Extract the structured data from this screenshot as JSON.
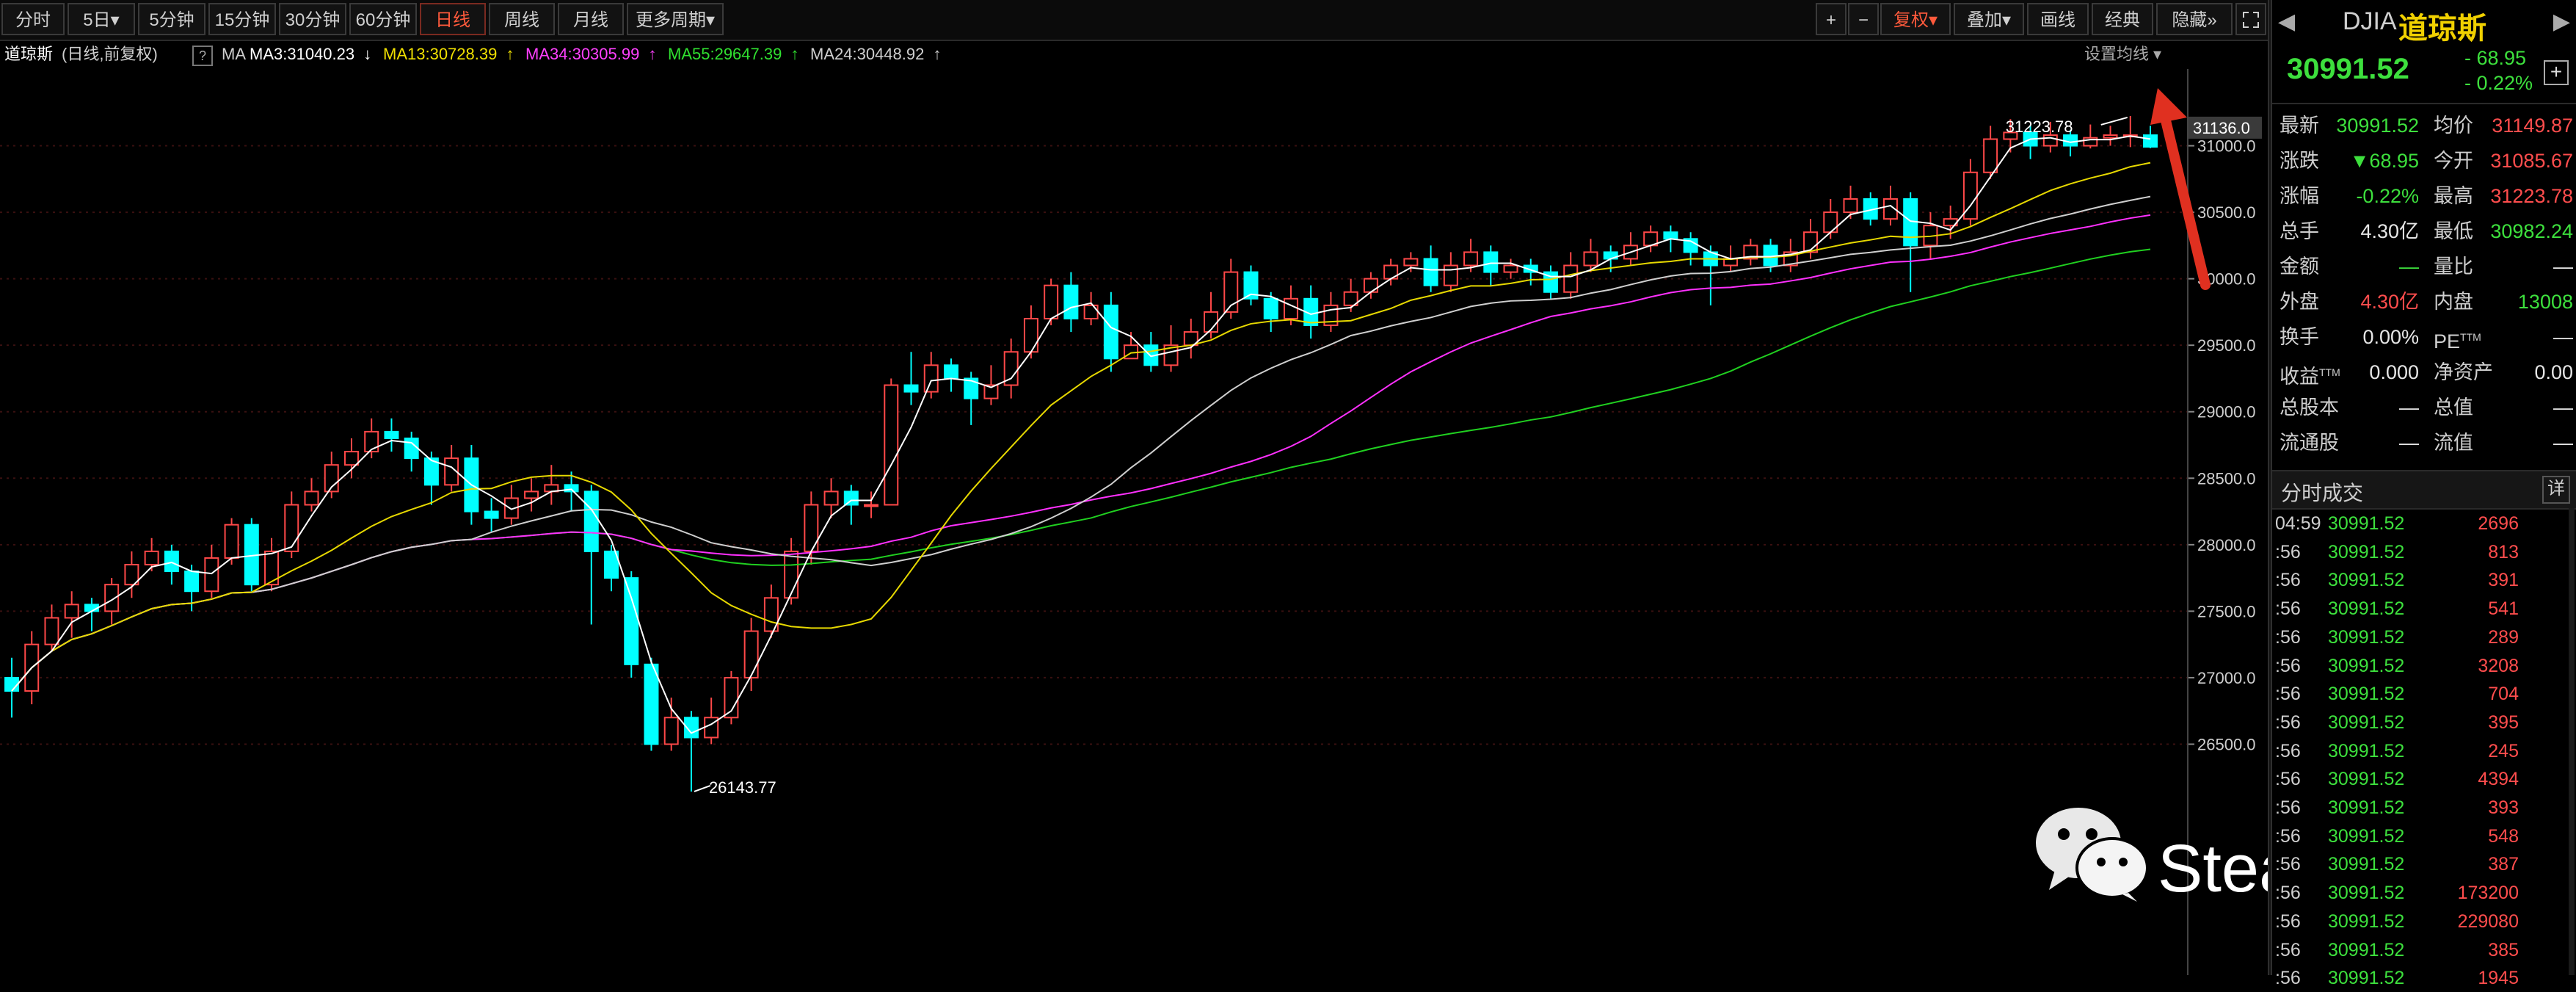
{
  "toolbar": {
    "periods": [
      "分时",
      "5日",
      "5分钟",
      "15分钟",
      "30分钟",
      "60分钟",
      "日线",
      "周线",
      "月线",
      "更多周期"
    ],
    "active_period": "日线",
    "more_arrow": "▾",
    "plus": "+",
    "minus": "−",
    "fuquan": "复权",
    "overlay": "叠加",
    "draw": "画线",
    "classic": "经典",
    "hide": "隐藏",
    "hide_arrows": "»",
    "fullscreen_icon": "fullscreen-icon"
  },
  "ma_bar": {
    "name": "道琼斯",
    "subtitle": "(日线,前复权)",
    "question": "?",
    "ma_label": "MA",
    "settings": "设置均线",
    "items": [
      {
        "text": "MA3:31040.23",
        "arrow": "↓",
        "color": "#ffffff"
      },
      {
        "text": "MA13:30728.39",
        "arrow": "↑",
        "color": "#f0e000"
      },
      {
        "text": "MA34:30305.99",
        "arrow": "↑",
        "color": "#ff40ff"
      },
      {
        "text": "MA55:29647.39",
        "arrow": "↑",
        "color": "#30e030"
      },
      {
        "text": "MA24:30448.92",
        "arrow": "↑",
        "color": "#cfcfcf"
      }
    ]
  },
  "chart_data": {
    "type": "candlestick",
    "ylim": [
      26143.77,
      31223.78
    ],
    "y_ticks": [
      "31000.0",
      "30500.0",
      "30000.0",
      "29500.0",
      "29000.0",
      "28500.0",
      "28000.0",
      "27500.0",
      "27000.0",
      "26500.0"
    ],
    "current_price_label": "31136.0",
    "high_label": "31223.78",
    "low_label": "26143.77",
    "colors": {
      "up": "#ff4848",
      "down": "#00ffff",
      "ma3": "#ffffff",
      "ma13": "#e6d800",
      "ma24": "#cfcfcf",
      "ma34": "#ff30ff",
      "ma55": "#20d020",
      "grid": "#3a1010"
    },
    "candles": [
      [
        27000,
        26900,
        27150,
        26700
      ],
      [
        26900,
        27250,
        27350,
        26800
      ],
      [
        27250,
        27450,
        27550,
        27200
      ],
      [
        27450,
        27550,
        27650,
        27300
      ],
      [
        27550,
        27500,
        27600,
        27350
      ],
      [
        27500,
        27700,
        27750,
        27400
      ],
      [
        27700,
        27850,
        27950,
        27600
      ],
      [
        27850,
        27950,
        28050,
        27800
      ],
      [
        27950,
        27800,
        28000,
        27700
      ],
      [
        27800,
        27650,
        27850,
        27500
      ],
      [
        27650,
        27900,
        28000,
        27600
      ],
      [
        27900,
        28150,
        28200,
        27850
      ],
      [
        28150,
        27700,
        28200,
        27650
      ],
      [
        27700,
        27950,
        28050,
        27650
      ],
      [
        27950,
        28300,
        28400,
        27900
      ],
      [
        28300,
        28400,
        28500,
        28250
      ],
      [
        28400,
        28600,
        28700,
        28350
      ],
      [
        28600,
        28700,
        28800,
        28500
      ],
      [
        28700,
        28850,
        28950,
        28650
      ],
      [
        28850,
        28800,
        28950,
        28700
      ],
      [
        28800,
        28650,
        28850,
        28550
      ],
      [
        28650,
        28450,
        28700,
        28300
      ],
      [
        28450,
        28650,
        28750,
        28400
      ],
      [
        28650,
        28250,
        28750,
        28150
      ],
      [
        28250,
        28200,
        28350,
        28100
      ],
      [
        28200,
        28350,
        28450,
        28150
      ],
      [
        28350,
        28400,
        28500,
        28250
      ],
      [
        28400,
        28450,
        28600,
        28300
      ],
      [
        28450,
        28400,
        28550,
        28250
      ],
      [
        28400,
        27950,
        28450,
        27400
      ],
      [
        27950,
        27750,
        28000,
        27650
      ],
      [
        27750,
        27100,
        27800,
        27000
      ],
      [
        27100,
        26500,
        27150,
        26450
      ],
      [
        26500,
        26700,
        26850,
        26450
      ],
      [
        26700,
        26550,
        26750,
        26144
      ],
      [
        26550,
        26700,
        26850,
        26500
      ],
      [
        26700,
        27000,
        27050,
        26650
      ],
      [
        27000,
        27350,
        27450,
        26900
      ],
      [
        27350,
        27600,
        27700,
        27300
      ],
      [
        27600,
        27950,
        28050,
        27550
      ],
      [
        27950,
        28300,
        28400,
        27850
      ],
      [
        28300,
        28400,
        28500,
        28200
      ],
      [
        28400,
        28300,
        28450,
        28150
      ],
      [
        28300,
        28300,
        28400,
        28200
      ],
      [
        28300,
        29200,
        29250,
        28950
      ],
      [
        29200,
        29150,
        29450,
        29050
      ],
      [
        29150,
        29350,
        29450,
        29100
      ],
      [
        29350,
        29250,
        29400,
        29150
      ],
      [
        29250,
        29100,
        29300,
        28900
      ],
      [
        29100,
        29200,
        29350,
        29050
      ],
      [
        29200,
        29450,
        29550,
        29100
      ],
      [
        29450,
        29700,
        29800,
        29400
      ],
      [
        29700,
        29950,
        30000,
        29650
      ],
      [
        29950,
        29700,
        30050,
        29600
      ],
      [
        29700,
        29800,
        29900,
        29650
      ],
      [
        29800,
        29400,
        29900,
        29300
      ],
      [
        29400,
        29500,
        29600,
        29400
      ],
      [
        29500,
        29350,
        29600,
        29300
      ],
      [
        29350,
        29500,
        29650,
        29300
      ],
      [
        29500,
        29600,
        29700,
        29400
      ],
      [
        29600,
        29750,
        29900,
        29550
      ],
      [
        29750,
        30050,
        30150,
        29700
      ],
      [
        30050,
        29850,
        30100,
        29800
      ],
      [
        29850,
        29700,
        29900,
        29600
      ],
      [
        29700,
        29850,
        29950,
        29650
      ],
      [
        29850,
        29650,
        29950,
        29550
      ],
      [
        29650,
        29800,
        29900,
        29600
      ],
      [
        29800,
        29900,
        30000,
        29750
      ],
      [
        29900,
        30000,
        30050,
        29850
      ],
      [
        30000,
        30100,
        30150,
        29950
      ],
      [
        30100,
        30150,
        30200,
        30050
      ],
      [
        30150,
        29950,
        30250,
        29900
      ],
      [
        29950,
        30100,
        30200,
        29900
      ],
      [
        30100,
        30200,
        30300,
        30050
      ],
      [
        30200,
        30050,
        30250,
        29950
      ],
      [
        30050,
        30100,
        30150,
        30000
      ],
      [
        30100,
        30050,
        30150,
        29950
      ],
      [
        30050,
        29900,
        30100,
        29850
      ],
      [
        29900,
        30100,
        30200,
        29850
      ],
      [
        30100,
        30200,
        30300,
        30050
      ],
      [
        30200,
        30150,
        30250,
        30050
      ],
      [
        30150,
        30250,
        30350,
        30100
      ],
      [
        30250,
        30350,
        30400,
        30200
      ],
      [
        30350,
        30300,
        30400,
        30200
      ],
      [
        30300,
        30200,
        30350,
        30100
      ],
      [
        30200,
        30100,
        30250,
        29800
      ],
      [
        30100,
        30150,
        30250,
        30050
      ],
      [
        30150,
        30250,
        30300,
        30100
      ],
      [
        30250,
        30100,
        30300,
        30050
      ],
      [
        30100,
        30200,
        30300,
        30050
      ],
      [
        30200,
        30350,
        30450,
        30150
      ],
      [
        30350,
        30500,
        30600,
        30300
      ],
      [
        30500,
        30600,
        30700,
        30450
      ],
      [
        30600,
        30450,
        30650,
        30400
      ],
      [
        30450,
        30600,
        30700,
        30400
      ],
      [
        30600,
        30250,
        30650,
        29900
      ],
      [
        30250,
        30400,
        30500,
        30150
      ],
      [
        30400,
        30450,
        30550,
        30300
      ],
      [
        30450,
        30800,
        30900,
        30400
      ],
      [
        30800,
        31050,
        31150,
        30750
      ],
      [
        31050,
        31100,
        31200,
        30950
      ],
      [
        31100,
        31000,
        31150,
        30900
      ],
      [
        31000,
        31080,
        31180,
        30950
      ],
      [
        31080,
        31000,
        31120,
        30920
      ],
      [
        31000,
        31060,
        31160,
        30980
      ],
      [
        31060,
        31080,
        31150,
        31000
      ],
      [
        31080,
        31080,
        31224,
        30990
      ],
      [
        31080,
        30992,
        31150,
        30982
      ]
    ]
  },
  "quote": {
    "code": "DJIA",
    "name": "道琼斯",
    "price": "30991.52",
    "change": "- 68.95",
    "change_pct": "- 0.22%",
    "add": "+",
    "rows": [
      {
        "l1": "最新",
        "v1": "30991.52",
        "c1": "green",
        "l2": "均价",
        "v2": "31149.87",
        "c2": "red"
      },
      {
        "l1": "涨跌",
        "v1": "▼68.95",
        "c1": "green",
        "l2": "今开",
        "v2": "31085.67",
        "c2": "red"
      },
      {
        "l1": "涨幅",
        "v1": "-0.22%",
        "c1": "green",
        "l2": "最高",
        "v2": "31223.78",
        "c2": "red"
      },
      {
        "l1": "总手",
        "v1": "4.30亿",
        "c1": "white",
        "l2": "最低",
        "v2": "30982.24",
        "c2": "green"
      },
      {
        "l1": "金额",
        "v1": "—",
        "c1": "green",
        "l2": "量比",
        "v2": "—",
        "c2": "white"
      },
      {
        "l1": "外盘",
        "v1": "4.30亿",
        "c1": "red",
        "l2": "内盘",
        "v2": "13008",
        "c2": "green"
      },
      {
        "l1": "换手",
        "v1": "0.00%",
        "c1": "white",
        "l2": "PE",
        "sup2": "TTM",
        "v2": "—",
        "c2": "white"
      },
      {
        "l1": "收益",
        "sup1": "TTM",
        "v1": "0.000",
        "c1": "white",
        "l2": "净资产",
        "v2": "0.00",
        "c2": "white"
      },
      {
        "l1": "总股本",
        "v1": "—",
        "c1": "white",
        "l2": "总值",
        "v2": "—",
        "c2": "white"
      },
      {
        "l1": "流通股",
        "v1": "—",
        "c1": "white",
        "l2": "流值",
        "v2": "—",
        "c2": "white"
      }
    ]
  },
  "ticks": {
    "title": "分时成交",
    "detail": "详",
    "rows": [
      {
        "time": "04:59",
        "price": "30991.52",
        "vol": "2696"
      },
      {
        "time": ":56",
        "price": "30991.52",
        "vol": "813"
      },
      {
        "time": ":56",
        "price": "30991.52",
        "vol": "391"
      },
      {
        "time": ":56",
        "price": "30991.52",
        "vol": "541"
      },
      {
        "time": ":56",
        "price": "30991.52",
        "vol": "289"
      },
      {
        "time": ":56",
        "price": "30991.52",
        "vol": "3208"
      },
      {
        "time": ":56",
        "price": "30991.52",
        "vol": "704"
      },
      {
        "time": ":56",
        "price": "30991.52",
        "vol": "395"
      },
      {
        "time": ":56",
        "price": "30991.52",
        "vol": "245"
      },
      {
        "time": ":56",
        "price": "30991.52",
        "vol": "4394"
      },
      {
        "time": ":56",
        "price": "30991.52",
        "vol": "393"
      },
      {
        "time": ":56",
        "price": "30991.52",
        "vol": "548"
      },
      {
        "time": ":56",
        "price": "30991.52",
        "vol": "387"
      },
      {
        "time": ":56",
        "price": "30991.52",
        "vol": "173200"
      },
      {
        "time": ":56",
        "price": "30991.52",
        "vol": "229080"
      },
      {
        "time": ":56",
        "price": "30991.52",
        "vol": "385"
      },
      {
        "time": ":56",
        "price": "30991.52",
        "vol": "1945"
      }
    ]
  },
  "watermark": {
    "text": "Steady老唐",
    "icon": "wechat-icon"
  }
}
